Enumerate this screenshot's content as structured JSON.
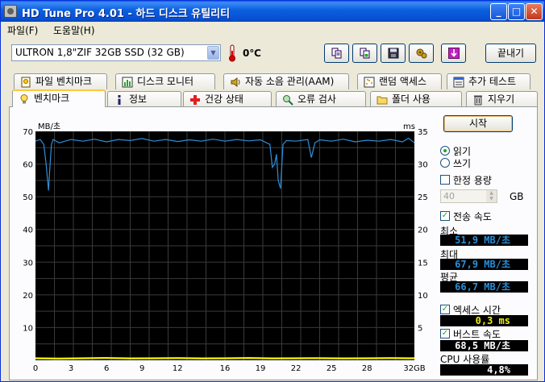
{
  "window": {
    "title": "HD Tune Pro 4.01 - 하드 디스크 유틸리티",
    "minimize": "_",
    "maximize": "□",
    "close": "✕"
  },
  "menu": [
    {
      "label": "파일(F)"
    },
    {
      "label": "도움말(H)"
    }
  ],
  "toolbar": {
    "drive": "ULTRON 1,8\"ZIF 32GB SSD (32 GB)",
    "temperature": "0℃",
    "buttons": [
      "copy-text-icon",
      "copy-screenshot-icon",
      "save-icon",
      "options-icon",
      "download-icon"
    ],
    "exit_label": "끝내기"
  },
  "tabs_top": [
    {
      "label": "파일 벤치마크",
      "icon": "file-benchmark-icon"
    },
    {
      "label": "디스크 모니터",
      "icon": "disk-monitor-icon"
    },
    {
      "label": "자동 소음 관리(AAM)",
      "icon": "speaker-icon"
    },
    {
      "label": "랜덤 액세스",
      "icon": "random-access-icon"
    },
    {
      "label": "추가 테스트",
      "icon": "extra-tests-icon"
    }
  ],
  "tabs_bottom": [
    {
      "label": "벤치마크",
      "icon": "lightbulb-icon"
    },
    {
      "label": "정보",
      "icon": "info-icon"
    },
    {
      "label": "건강 상태",
      "icon": "health-cross-icon"
    },
    {
      "label": "오류 검사",
      "icon": "magnifier-icon"
    },
    {
      "label": "폴더 사용",
      "icon": "folder-icon"
    },
    {
      "label": "지우기",
      "icon": "trash-icon"
    }
  ],
  "controls": {
    "start_label": "시작",
    "read_label": "읽기",
    "write_label": "쓰기",
    "mode": "read",
    "short_stroke_label": "한정 용량",
    "short_stroke_checked": false,
    "short_stroke_value": "40",
    "short_stroke_unit": "GB",
    "transfer_rate_label": "전송 속도",
    "transfer_rate_checked": true,
    "min_label": "최소",
    "min_value": "51,9 MB/초",
    "max_label": "최대",
    "max_value": "67,9 MB/초",
    "avg_label": "평균",
    "avg_value": "66,7 MB/초",
    "access_time_label": "엑세스 시간",
    "access_time_checked": true,
    "access_time_value": "0,3 ms",
    "burst_rate_label": "버스트 속도",
    "burst_rate_checked": true,
    "burst_rate_value": "68,5 MB/초",
    "cpu_label": "CPU 사용률",
    "cpu_value": "4,8%"
  },
  "chart_data": {
    "type": "line",
    "ylabel_left": "MB/초",
    "ylabel_right": "ms",
    "ylim_left": [
      0,
      70
    ],
    "ylim_right": [
      0,
      35
    ],
    "yticks_left": [
      "70",
      "60",
      "50",
      "40",
      "30",
      "20",
      "10"
    ],
    "yticks_right": [
      "35",
      "30",
      "25",
      "20",
      "15",
      "10",
      "5"
    ],
    "xlim": [
      0,
      32
    ],
    "xticks": [
      "0",
      "3",
      "6",
      "9",
      "12",
      "16",
      "19",
      "22",
      "25",
      "28",
      "32GB"
    ],
    "grid": true,
    "colors": {
      "background": "#000000",
      "grid": "#3a3a3a",
      "transfer": "#2f8fd8",
      "access": "#e8e800",
      "axis_text": "#000000"
    },
    "series": [
      {
        "name": "전송 속도",
        "axis": "left",
        "x": [
          0,
          0.4,
          0.7,
          0.9,
          1.0,
          1.1,
          1.2,
          1.35,
          1.5,
          2.0,
          3.0,
          4.0,
          5.0,
          6.0,
          7.0,
          8.0,
          9.0,
          10.0,
          11.0,
          12.0,
          13.0,
          14.0,
          15.0,
          16.0,
          17.0,
          18.0,
          19.0,
          19.8,
          20.0,
          20.2,
          20.35,
          20.5,
          20.7,
          20.9,
          21.2,
          22.0,
          23.0,
          23.3,
          23.6,
          24.0,
          25.0,
          26.0,
          27.0,
          28.0,
          29.0,
          30.0,
          31.0,
          31.5,
          32.0
        ],
        "y": [
          67,
          67.5,
          66,
          60,
          56,
          51.9,
          58,
          66,
          67.5,
          66.5,
          67.5,
          67,
          67.6,
          66.8,
          67.5,
          67.2,
          67.8,
          67,
          67.5,
          66.9,
          67.4,
          67,
          67.6,
          67,
          67.5,
          67.1,
          67.4,
          66,
          59,
          60,
          63,
          55,
          52.5,
          66,
          67.2,
          67,
          67.5,
          62,
          66.5,
          67.4,
          67,
          67.6,
          66.8,
          67.3,
          67,
          67.5,
          66.8,
          67.9,
          66.5
        ]
      },
      {
        "name": "엑세스 시간",
        "axis": "right",
        "x": [
          0,
          2,
          4,
          6,
          8,
          10,
          12,
          14,
          16,
          18,
          20,
          22,
          24,
          26,
          28,
          30,
          32
        ],
        "y": [
          0.3,
          0.25,
          0.3,
          0.35,
          0.28,
          0.3,
          0.32,
          0.27,
          0.3,
          0.33,
          0.28,
          0.3,
          0.31,
          0.27,
          0.3,
          0.32,
          0.3
        ]
      }
    ]
  }
}
